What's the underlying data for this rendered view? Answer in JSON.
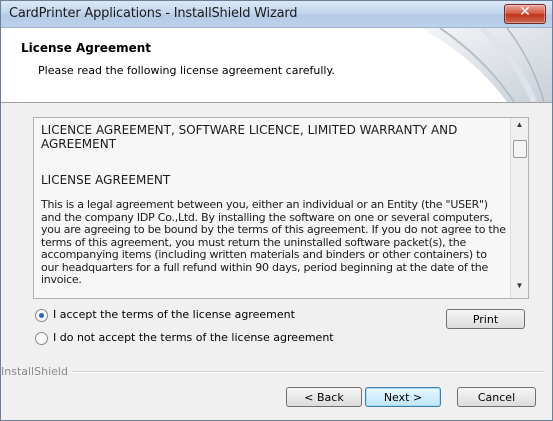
{
  "window": {
    "title": "CardPrinter Applications - InstallShield Wizard",
    "close_glyph": "✕"
  },
  "header": {
    "title": "License Agreement",
    "subtitle": "Please read the following license agreement carefully."
  },
  "license": {
    "heading": "LICENCE AGREEMENT, SOFTWARE LICENCE, LIMITED WARRANTY AND AGREEMENT",
    "heading2": "LICENSE AGREEMENT",
    "body": "This is a legal agreement between you, either an individual or an Entity (the \"USER\") and the company IDP Co.,Ltd. By installing the software on one or several computers, you are agreeing to be bound by the terms of this agreement. If you do not agree to the terms of this agreement, you must return the uninstalled software packet(s), the accompanying items (including written materials and binders or other containers) to our headquarters for a full refund within 90 days, period beginning at the date of the invoice."
  },
  "options": {
    "accept_label": "I accept the terms of the license agreement",
    "decline_label": "I do not accept the terms of the license agreement",
    "selected": "accept"
  },
  "buttons": {
    "print": "Print",
    "back": "< Back",
    "next": "Next >",
    "cancel": "Cancel"
  },
  "footer": {
    "brand": "InstallShield"
  },
  "scrollbar": {
    "up_glyph": "▲",
    "down_glyph": "▼"
  }
}
